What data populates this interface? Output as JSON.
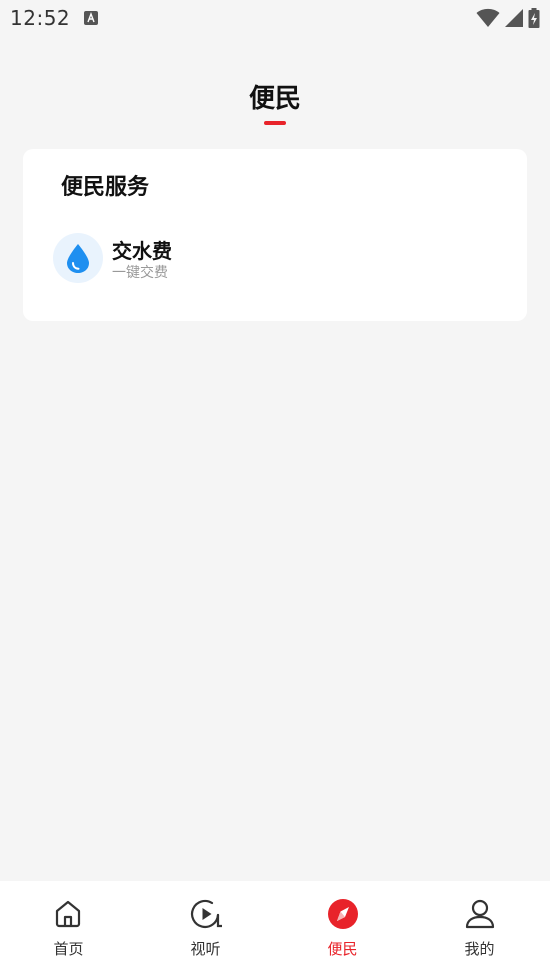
{
  "status_bar": {
    "time": "12:52"
  },
  "header": {
    "title": "便民"
  },
  "service_card": {
    "title": "便民服务",
    "items": [
      {
        "name": "交水费",
        "desc": "一键交费",
        "icon": "water-drop-icon"
      }
    ]
  },
  "bottom_nav": {
    "items": [
      {
        "label": "首页",
        "icon": "home-icon"
      },
      {
        "label": "视听",
        "icon": "play-circle-icon"
      },
      {
        "label": "便民",
        "icon": "compass-icon",
        "active": true
      },
      {
        "label": "我的",
        "icon": "person-icon"
      }
    ]
  },
  "colors": {
    "accent": "#e8232a",
    "water_blue": "#1e8ff0",
    "background": "#f5f5f5"
  }
}
